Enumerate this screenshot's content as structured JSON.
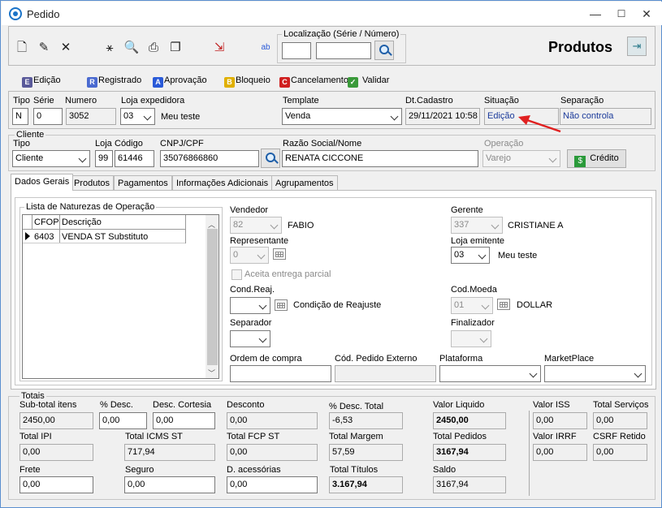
{
  "window": {
    "title": "Pedido",
    "minimize": "—",
    "maximize": "☐",
    "close": "✕"
  },
  "toolbar": {
    "icons": [
      "new-document-icon",
      "edit-icon",
      "delete-icon",
      "wand-icon",
      "preview-icon",
      "print-icon",
      "copy-icon",
      "export-icon",
      "abc-icon"
    ],
    "localizacao_label": "Localização (Série / Número)",
    "serie": "",
    "numero": "",
    "produtos_label": "Produtos"
  },
  "actions": [
    {
      "label": "Edição",
      "icon_letter": "E",
      "color": "#5a5a9a"
    },
    {
      "label": "Registrado",
      "icon_letter": "R",
      "color": "#4a6ad0"
    },
    {
      "label": "Aprovação",
      "icon_letter": "A",
      "color": "#2a5ad8"
    },
    {
      "label": "Bloqueio",
      "icon_letter": "B",
      "color": "#e0b000"
    },
    {
      "label": "Cancelamento",
      "icon_letter": "C",
      "color": "#d02020"
    },
    {
      "label": "Validar",
      "icon_letter": "✓",
      "color": "#3a9a3a"
    }
  ],
  "header": {
    "tipo_label": "Tipo",
    "tipo": "N",
    "serie_label": "Série",
    "serie": "0",
    "numero_label": "Numero",
    "numero": "3052",
    "loja_exp_label": "Loja expedidora",
    "loja_exp": "03",
    "loja_exp_name": "Meu teste",
    "template_label": "Template",
    "template": "Venda",
    "dtcadastro_label": "Dt.Cadastro",
    "dtcadastro": "29/11/2021 10:58",
    "situacao_label": "Situação",
    "situacao": "Edição",
    "separacao_label": "Separação",
    "separacao": "Não controla"
  },
  "cliente": {
    "group_label": "Cliente",
    "tipo_label": "Tipo",
    "tipo": "Cliente",
    "loja_label": "Loja",
    "loja": "99",
    "codigo_label": "Código",
    "codigo": "61446",
    "cnpj_label": "CNPJ/CPF",
    "cnpj": "35076866860",
    "razao_label": "Razão Social/Nome",
    "razao": "RENATA CICCONE",
    "operacao_label": "Operação",
    "operacao": "Varejo",
    "credito_label": "Crédito"
  },
  "tabs": [
    "Dados Gerais",
    "Produtos",
    "Pagamentos",
    "Informações Adicionais",
    "Agrupamentos"
  ],
  "naturezas": {
    "label": "Lista de Naturezas de Operação",
    "columns": [
      "CFOP",
      "Descrição"
    ],
    "rows": [
      {
        "cfop": "6403",
        "descricao": "VENDA ST Substituto"
      }
    ]
  },
  "dados": {
    "vendedor_label": "Vendedor",
    "vendedor_code": "82",
    "vendedor_name": "FABIO",
    "gerente_label": "Gerente",
    "gerente_code": "337",
    "gerente_name": "CRISTIANE A",
    "representante_label": "Representante",
    "representante_code": "0",
    "loja_emitente_label": "Loja emitente",
    "loja_emitente_code": "03",
    "loja_emitente_name": "Meu teste",
    "aceita_label": "Aceita entrega parcial",
    "condreaj_label": "Cond.Reaj.",
    "condreaj_name": "Condição de Reajuste",
    "codmoeda_label": "Cod.Moeda",
    "codmoeda_code": "01",
    "codmoeda_name": "DOLLAR",
    "separador_label": "Separador",
    "finalizador_label": "Finalizador",
    "ordem_label": "Ordem de compra",
    "cod_externo_label": "Cód. Pedido Externo",
    "plataforma_label": "Plataforma",
    "marketplace_label": "MarketPlace"
  },
  "totais": {
    "group_label": "Totais",
    "subtotal_label": "Sub-total itens",
    "subtotal": "2450,00",
    "pdesc_label": "% Desc.",
    "pdesc": "0,00",
    "desc_cortesia_label": "Desc. Cortesia",
    "desc_cortesia": "0,00",
    "desconto_label": "Desconto",
    "desconto": "0,00",
    "pdesc_total_label": "% Desc. Total",
    "pdesc_total": "-6,53",
    "valor_liquido_label": "Valor Liquido",
    "valor_liquido": "2450,00",
    "valor_iss_label": "Valor ISS",
    "valor_iss": "0,00",
    "total_servicos_label": "Total Serviços",
    "total_servicos": "0,00",
    "total_ipi_label": "Total IPI",
    "total_ipi": "0,00",
    "total_icms_st_label": "Total ICMS ST",
    "total_icms_st": "717,94",
    "total_fcp_st_label": "Total FCP ST",
    "total_fcp_st": "0,00",
    "total_margem_label": "Total Margem",
    "total_margem": "57,59",
    "total_pedidos_label": "Total Pedidos",
    "total_pedidos": "3167,94",
    "valor_irrf_label": "Valor IRRF",
    "valor_irrf": "0,00",
    "csrf_label": "CSRF Retido",
    "csrf": "0,00",
    "frete_label": "Frete",
    "frete": "0,00",
    "seguro_label": "Seguro",
    "seguro": "0,00",
    "acessorias_label": "D. acessórias",
    "acessorias": "0,00",
    "total_titulos_label": "Total Títulos",
    "total_titulos": "3.167,94",
    "saldo_label": "Saldo",
    "saldo": "3167,94"
  },
  "annotation": {
    "color": "#e02020"
  }
}
